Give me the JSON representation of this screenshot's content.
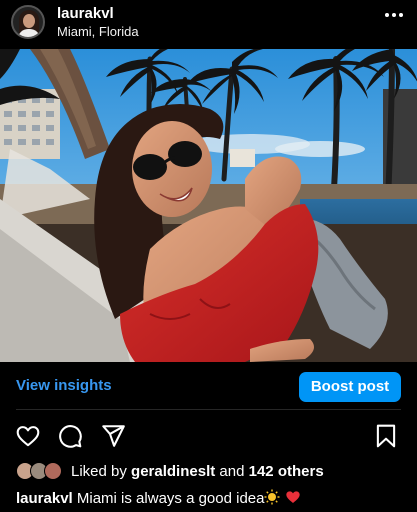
{
  "post": {
    "username": "laurakvl",
    "location": "Miami, Florida",
    "more_icon": "more-horizontal-icon"
  },
  "insights": {
    "view_label": "View insights",
    "boost_label": "Boost post"
  },
  "actions": {
    "icons": [
      "heart-icon",
      "comment-icon",
      "share-icon",
      "bookmark-icon"
    ]
  },
  "likes": {
    "prefix": "Liked by",
    "liker": "geraldineslt",
    "connector": "and",
    "others": "142 others"
  },
  "caption": {
    "username": "laurakvl",
    "text": "Miami is always a good idea",
    "emoji_sun": "☀️",
    "emoji_heart": "❤️"
  },
  "colors": {
    "accent_link": "#3897f0",
    "button_blue": "#0095f6",
    "heart_red": "#e8303a"
  }
}
